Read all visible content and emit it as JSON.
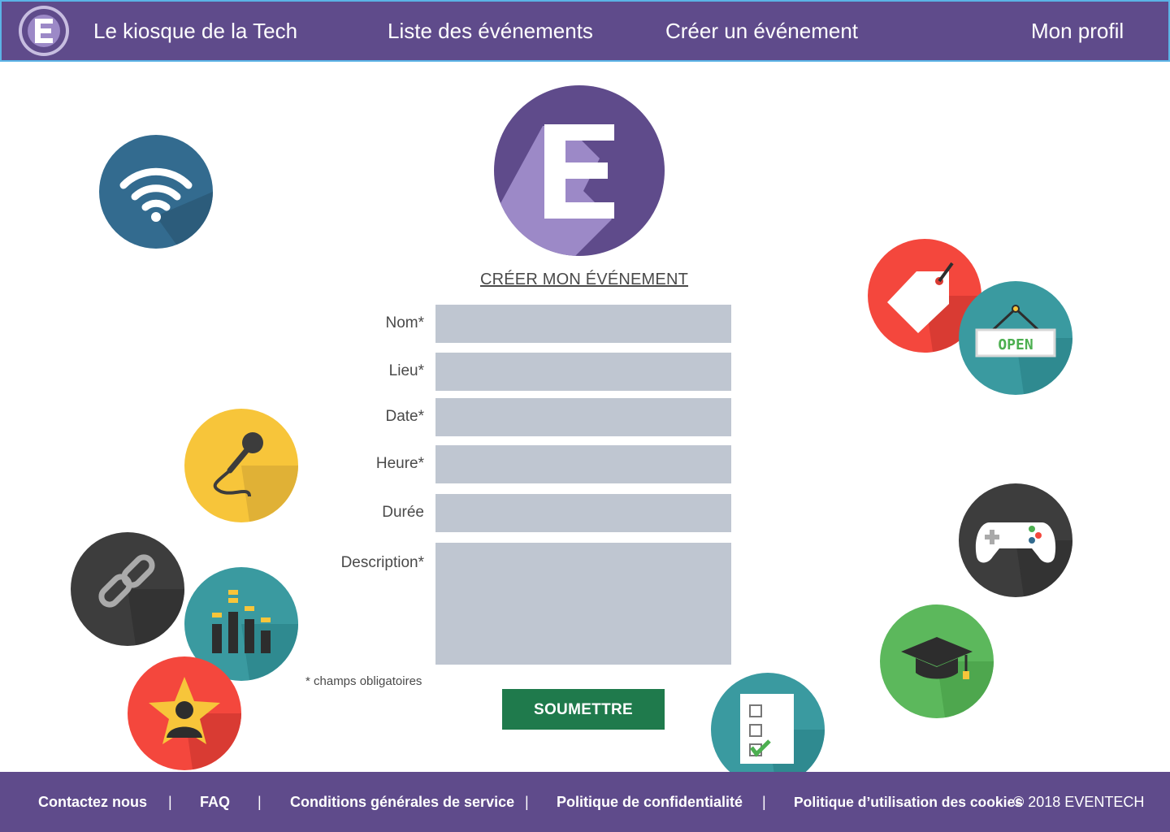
{
  "header": {
    "brand": "Le kiosque de la Tech",
    "nav": {
      "events": "Liste des événements",
      "create": "Créer un événement",
      "profile": "Mon profil"
    }
  },
  "logo": {
    "letter": "E"
  },
  "form": {
    "title": "CRÉER MON ÉVÉNEMENT",
    "fields": [
      {
        "label": "Nom*"
      },
      {
        "label": "Lieu*"
      },
      {
        "label": "Date*"
      },
      {
        "label": "Heure*"
      },
      {
        "label": "Durée"
      },
      {
        "label": "Description*"
      }
    ],
    "required_note": "* champs obligatoires",
    "submit_label": "SOUMETTRE"
  },
  "icons": {
    "open_sign": "OPEN"
  },
  "footer": {
    "links": {
      "contact": "Contactez nous",
      "faq": "FAQ",
      "terms": "Conditions générales de service",
      "privacy": "Politique de confidentialité",
      "cookies": "Politique d’utilisation des cookies"
    },
    "separator": "|",
    "copyright": "© 2018 EVENTECH"
  },
  "colors": {
    "primary": "#5f4b8b",
    "input_bg": "#bfc6d1",
    "submit": "#1f7a4c"
  }
}
